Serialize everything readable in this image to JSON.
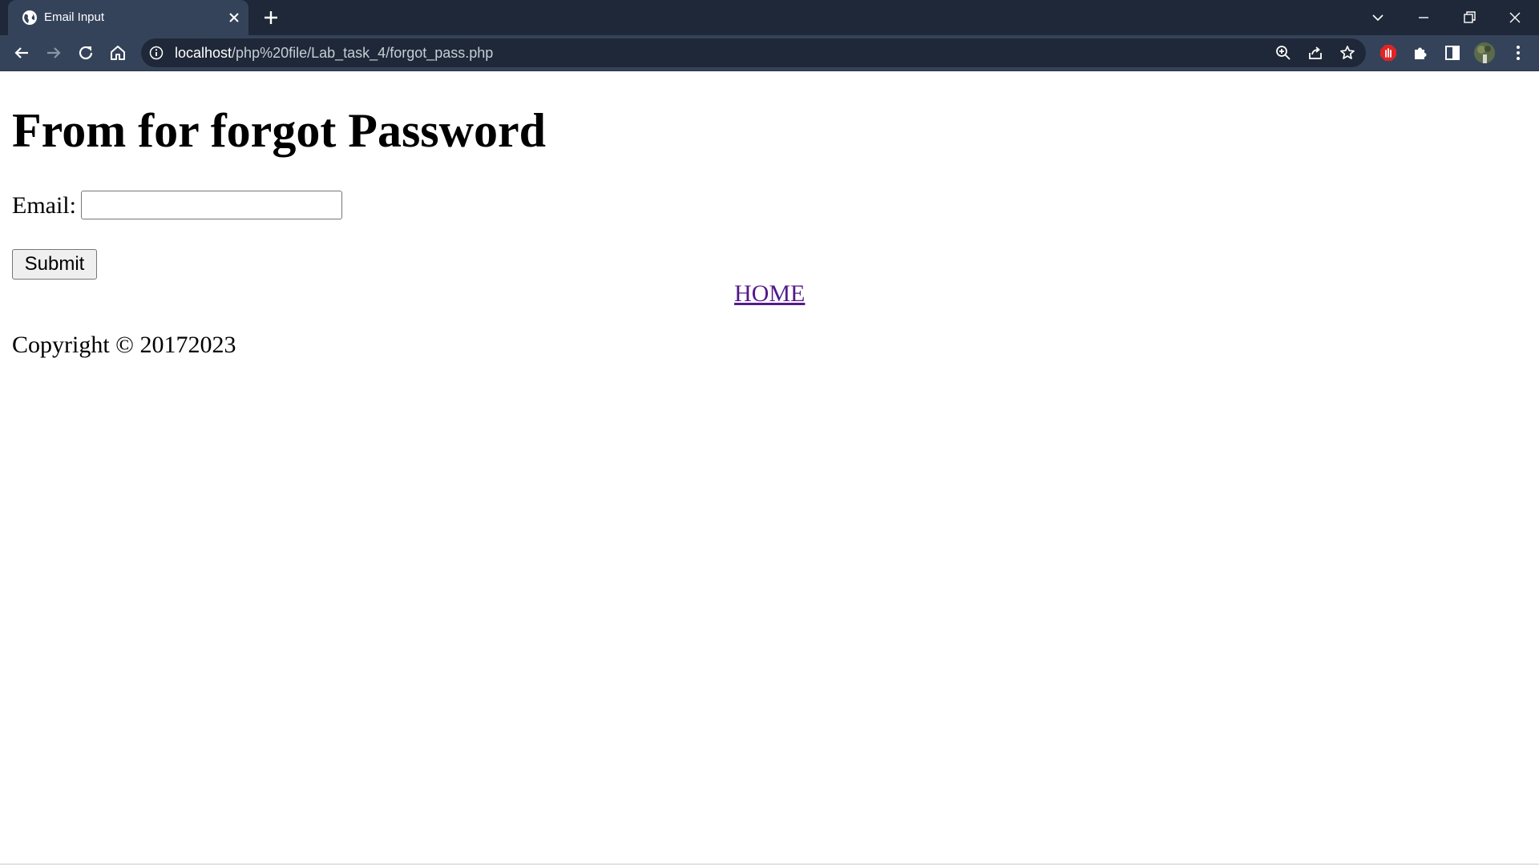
{
  "browser": {
    "tab": {
      "title": "Email Input",
      "favicon": "globe-icon",
      "close": "close-icon"
    },
    "new_tab": "plus-icon",
    "window_controls": [
      "chevron-down-icon",
      "minimize-icon",
      "restore-icon",
      "close-icon"
    ],
    "address": {
      "host": "localhost",
      "path": "/php%20file/Lab_task_4/forgot_pass.php"
    },
    "nav_icons": [
      "back-arrow-icon",
      "forward-arrow-icon",
      "reload-icon",
      "home-icon"
    ],
    "omnibox_icons": [
      "zoom-icon",
      "share-icon",
      "bookmark-star-icon"
    ],
    "extension_icons": [
      "adblock-extension-icon",
      "puzzle-extensions-icon",
      "side-panel-icon",
      "profile-avatar",
      "kebab-menu-icon"
    ]
  },
  "page": {
    "heading": "From for forgot Password",
    "email_label": "Email:",
    "email_value": "",
    "submit_label": "Submit",
    "home_link": "HOME",
    "copyright": "Copyright © 20172023"
  },
  "colors": {
    "tabstrip": "#1f2838",
    "toolbar": "#35435a",
    "visited_link": "#551a8b"
  }
}
